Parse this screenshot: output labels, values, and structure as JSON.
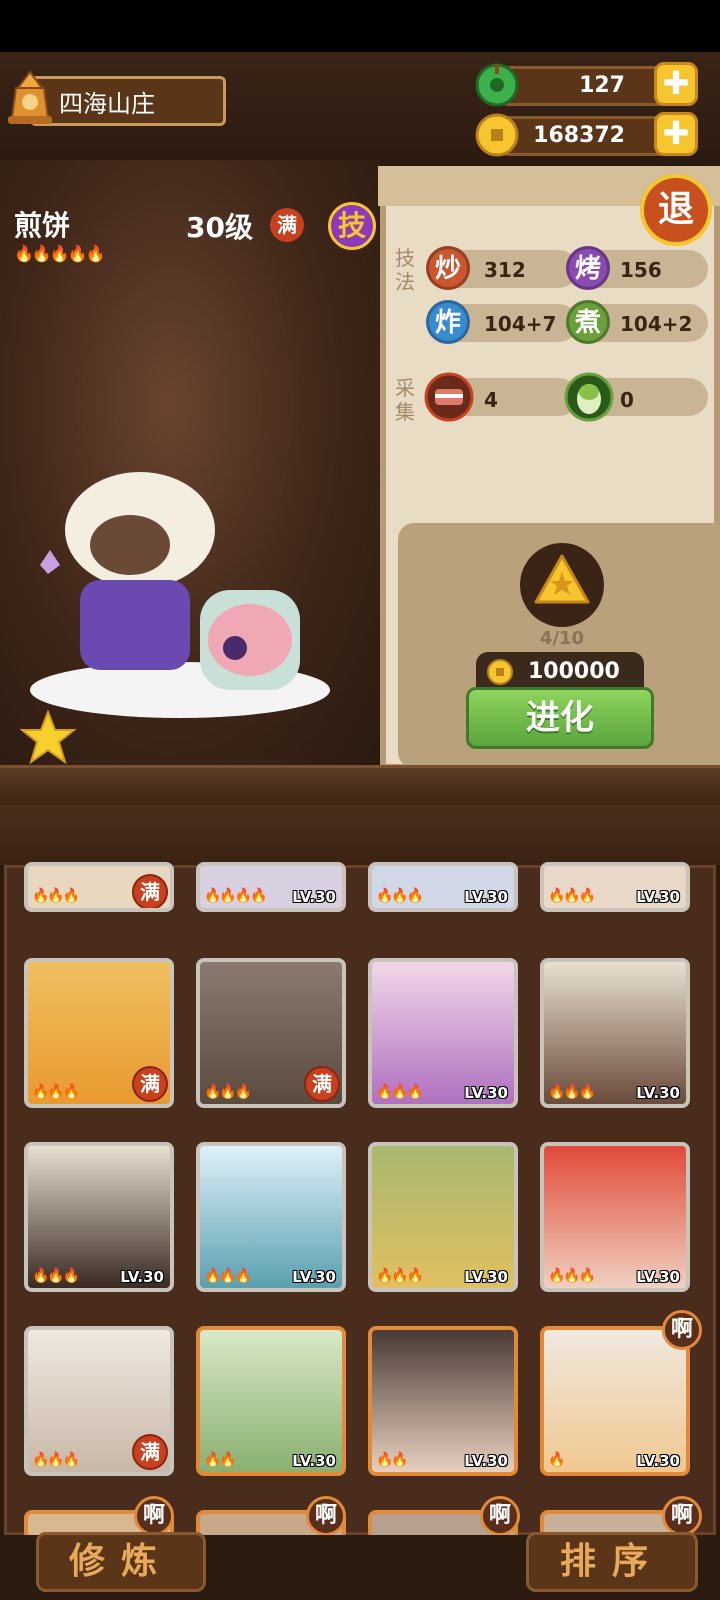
{
  "header": {
    "place_name": "四海山庄",
    "jade_count": "127",
    "coin_count": "168372",
    "plus_label": "✚",
    "exit_label": "退"
  },
  "chef": {
    "name": "煎饼",
    "level": "30级",
    "max_badge": "满",
    "skill_button": "技",
    "flames": "🔥🔥🔥🔥🔥"
  },
  "stats": {
    "skills_label": "技法",
    "gather_label": "采集",
    "items": [
      {
        "icon": "炒",
        "value": "312",
        "color": "#c9562e"
      },
      {
        "icon": "烤",
        "value": "156",
        "color": "#8a4ab0"
      },
      {
        "icon": "炸",
        "value": "104+7",
        "color": "#3a8ad0"
      },
      {
        "icon": "煮",
        "value": "104+2",
        "color": "#6aa03a"
      },
      {
        "icon": "",
        "value": "4",
        "color": "#b8402a"
      },
      {
        "icon": "",
        "value": "0",
        "color": "#7ab04a"
      }
    ]
  },
  "evolve": {
    "progress": "4/10",
    "cost": "100000",
    "button_label": "进化"
  },
  "cards": {
    "lv_label": "LV.30",
    "max_label": "满",
    "ah_label": "啊"
  },
  "bottom": {
    "train_label": "修炼",
    "sort_label": "排序"
  },
  "colors": {
    "accent_gold": "#f7c52e",
    "wood_dark": "#3a2416",
    "green_button": "#6ab844"
  }
}
